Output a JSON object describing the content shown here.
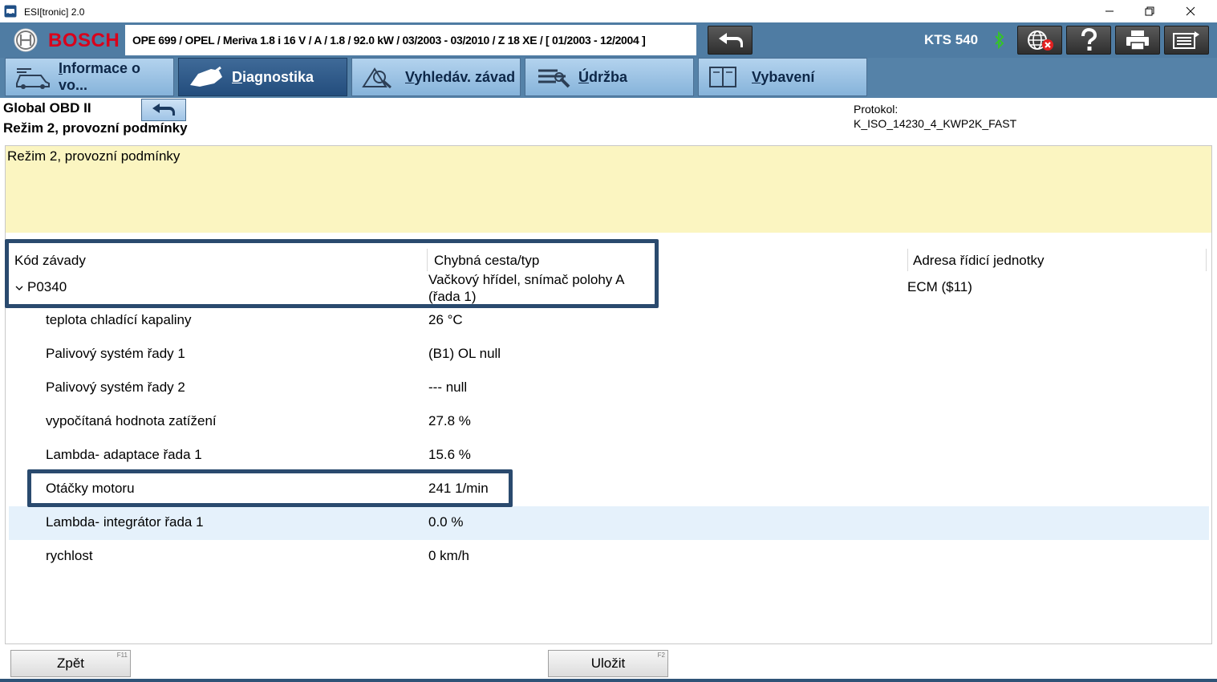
{
  "window": {
    "title": "ESI[tronic] 2.0"
  },
  "header": {
    "brand": "BOSCH",
    "vehicle": "OPE 699 / OPEL / Meriva 1.8 i 16 V / A / 1.8 / 92.0 kW / 03/2003 - 03/2010 / Z 18 XE / [ 01/2003 - 12/2004 ]",
    "device": "KTS 540",
    "brand_color": "#d9001b",
    "toolbar_color": "#4f7ca3"
  },
  "tabs": [
    {
      "label": "Informace o vo...",
      "icon": "vehicle-info-icon",
      "active": false
    },
    {
      "label": "Diagnostika",
      "icon": "diagnosis-plug-icon",
      "active": true
    },
    {
      "label": "Vyhledáv. závad",
      "icon": "troubleshoot-icon",
      "active": false
    },
    {
      "label": "Údržba",
      "icon": "maintenance-icon",
      "active": false
    },
    {
      "label": "Vybavení",
      "icon": "equipment-book-icon",
      "active": false
    }
  ],
  "info": {
    "title": "Global OBD II",
    "subtitle": "Režim 2,  provozní podmínky",
    "protocol_label": "Protokol:",
    "protocol_value": "K_ISO_14230_4_KWP2K_FAST"
  },
  "description": "Režim 2,  provozní podmínky",
  "table": {
    "headers": {
      "code": "Kód závady",
      "path": "Chybná cesta/typ",
      "address": "Adresa řídicí jednotky"
    },
    "dtc": {
      "code": "P0340",
      "text": "Vačkový hřídel, snímač polohy A (řada 1)",
      "ecu": "ECM ($11)"
    },
    "rows": [
      {
        "name": "teplota chladící kapaliny",
        "value": "26 °C"
      },
      {
        "name": "Palivový systém řady 1",
        "value": "(B1) OL null"
      },
      {
        "name": "Palivový systém řady 2",
        "value": "--- null"
      },
      {
        "name": "vypočítaná hodnota zatížení",
        "value": "27.8 %"
      },
      {
        "name": "Lambda- adaptace řada 1",
        "value": "15.6 %"
      },
      {
        "name": "Otáčky motoru",
        "value": "241 1/min"
      },
      {
        "name": "Lambda- integrátor řada 1",
        "value": "0.0 %"
      },
      {
        "name": "rychlost",
        "value": "0 km/h"
      }
    ]
  },
  "buttons": {
    "back": {
      "label": "Zpět",
      "fkey": "F11"
    },
    "save": {
      "label": "Uložit",
      "fkey": "F2"
    }
  }
}
